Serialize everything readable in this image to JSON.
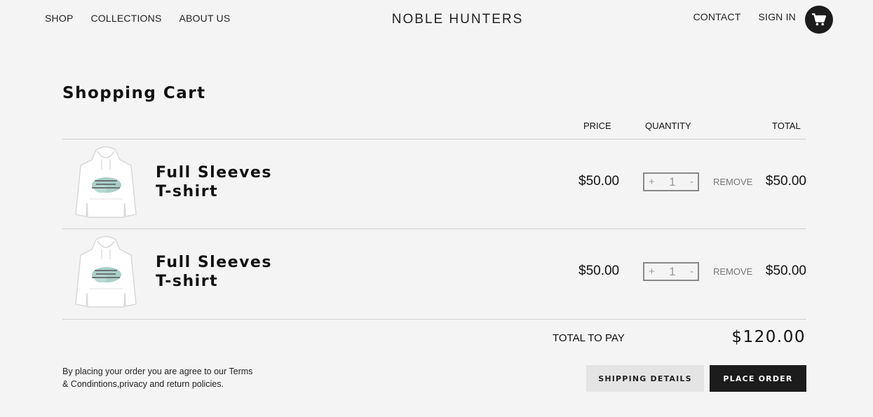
{
  "header": {
    "nav_left": [
      "SHOP",
      "COLLECTIONS",
      "ABOUT US"
    ],
    "brand": "NOBLE HUNTERS",
    "nav_right": [
      "CONTACT",
      "SIGN IN"
    ],
    "cart_icon": "shopping-cart-icon"
  },
  "cart": {
    "title": "Shopping Cart",
    "columns": {
      "price": "PRICE",
      "quantity": "QUANTITY",
      "total": "TOTAL"
    },
    "items": [
      {
        "name_line1": "Full Sleeves",
        "name_line2": "T-shirt",
        "price": "$50.00",
        "quantity": "1",
        "plus": "+",
        "minus": "-",
        "remove": "REMOVE",
        "total": "$50.00",
        "image": "white-hoodie-image"
      },
      {
        "name_line1": "Full Sleeves",
        "name_line2": "T-shirt",
        "price": "$50.00",
        "quantity": "1",
        "plus": "+",
        "minus": "-",
        "remove": "REMOVE",
        "total": "$50.00",
        "image": "white-hoodie-image"
      }
    ],
    "total_label": "TOTAL TO PAY",
    "total_value": "$120.00",
    "terms_line1": "By placing your order you are agree to our Terms",
    "terms_line2": "& Condintions,privacy and return policies.",
    "shipping_button": "SHIPPING DETAILS",
    "order_button": "PLACE ORDER"
  }
}
